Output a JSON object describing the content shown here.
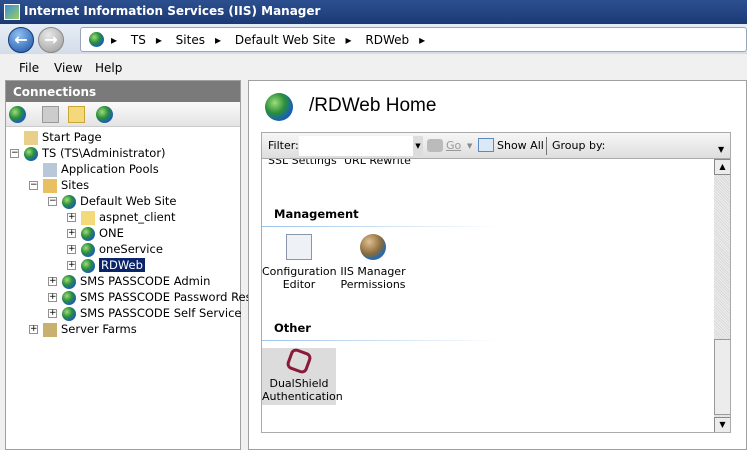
{
  "window": {
    "title": "Internet Information Services (IIS) Manager"
  },
  "breadcrumb": [
    "TS",
    "Sites",
    "Default Web Site",
    "RDWeb"
  ],
  "menu": [
    "File",
    "View",
    "Help"
  ],
  "connections": {
    "title": "Connections",
    "tree": [
      {
        "label": "Start Page"
      },
      {
        "label": "TS (TS\\Administrator)"
      },
      {
        "label": "Application Pools"
      },
      {
        "label": "Sites"
      },
      {
        "label": "Default Web Site"
      },
      {
        "label": "aspnet_client"
      },
      {
        "label": "ONE"
      },
      {
        "label": "oneService"
      },
      {
        "label": "RDWeb",
        "selected": true
      },
      {
        "label": "SMS PASSCODE Admin"
      },
      {
        "label": "SMS PASSCODE Password Reset"
      },
      {
        "label": "SMS PASSCODE Self Service"
      },
      {
        "label": "Server Farms"
      }
    ]
  },
  "main": {
    "title": "/RDWeb Home",
    "filter": {
      "label": "Filter:",
      "value": "",
      "go": "Go",
      "show_all": "Show All",
      "group_by": "Group by:"
    },
    "partial_items": [
      "SSL Settings",
      "URL Rewrite"
    ],
    "groups": [
      {
        "name": "Management",
        "items": [
          {
            "label": "Configuration Editor",
            "l1": "Configuration",
            "l2": "Editor"
          },
          {
            "label": "IIS Manager Permissions",
            "l1": "IIS Manager",
            "l2": "Permissions"
          }
        ]
      },
      {
        "name": "Other",
        "items": [
          {
            "label": "DualShield Authentication",
            "l1": "DualShield",
            "l2": "Authentication"
          }
        ]
      }
    ]
  }
}
